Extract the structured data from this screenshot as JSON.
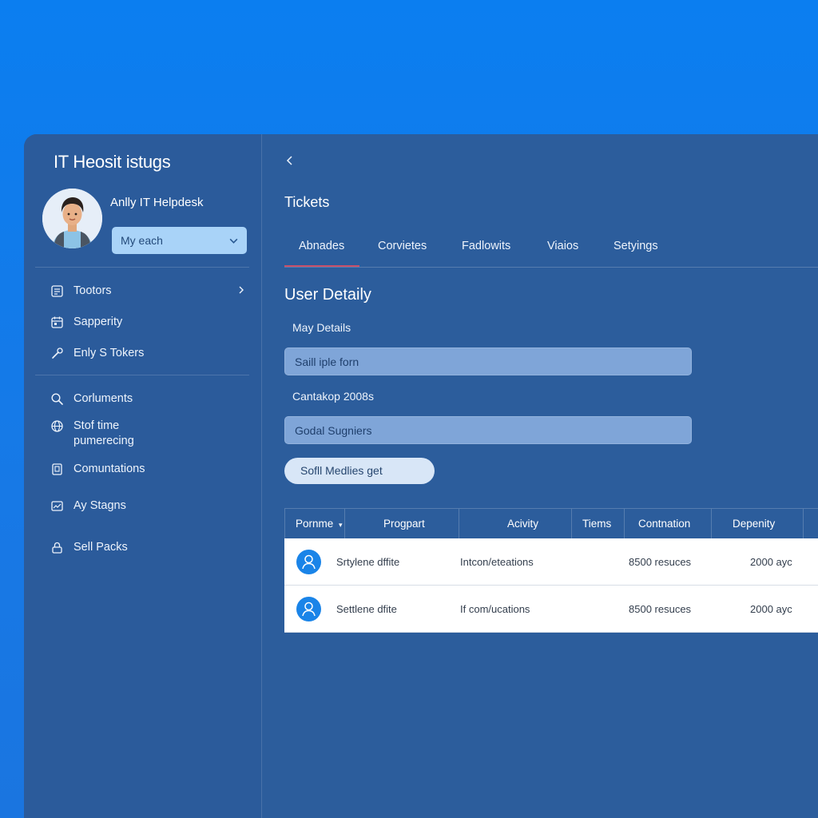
{
  "app": {
    "title": "IT Heosit istugs"
  },
  "user": {
    "name": "Anlly IT Helpdesk",
    "select_value": "My each"
  },
  "sidebar": {
    "items": [
      {
        "label": "Tootors",
        "icon": "ticket-icon",
        "has_chevron": true
      },
      {
        "label": "Sapperity",
        "icon": "calendar-icon"
      },
      {
        "label": "Enly S Tokers",
        "icon": "wrench-icon"
      },
      {
        "label": "Corluments",
        "icon": "search-icon"
      },
      {
        "label": "Stof time",
        "label2": "pumerecing",
        "icon": "globe-icon"
      },
      {
        "label": "Comuntations",
        "icon": "document-icon"
      },
      {
        "label": "Ay Stagns",
        "icon": "chart-icon"
      },
      {
        "label": "Sell Packs",
        "icon": "lock-icon"
      }
    ]
  },
  "main": {
    "section_title": "Tickets",
    "tabs": [
      "Abnades",
      "Corvietes",
      "Fadlowits",
      "Viaios",
      "Setyings"
    ],
    "form": {
      "title": "User Detaily",
      "label1": "May Details",
      "field1": "Saill iple forn",
      "label2": "Cantakop 2008s",
      "field2": "Godal Sugniers",
      "button": "Sofll Medlies get"
    },
    "table": {
      "headers": [
        "Pornme",
        "Progpart",
        "Acivity",
        "Tiems",
        "Contnation",
        "Depenity"
      ],
      "rows": [
        {
          "name": "Srtylene dffite",
          "activity": "Intcon/eteations",
          "items": "8500 resuces",
          "date": "2000 ayc"
        },
        {
          "name": "Settlene dfite",
          "activity": "If com/ucations",
          "items": "8500 resuces",
          "date": "2000 ayc"
        }
      ]
    }
  },
  "colors": {
    "background": "#0b7ef0",
    "panel": "#2c5d9c",
    "accent": "#1a84e8",
    "tab_active": "#c9506a",
    "select_bg": "#a9d3f8",
    "field_bg": "#7fa5d8"
  }
}
